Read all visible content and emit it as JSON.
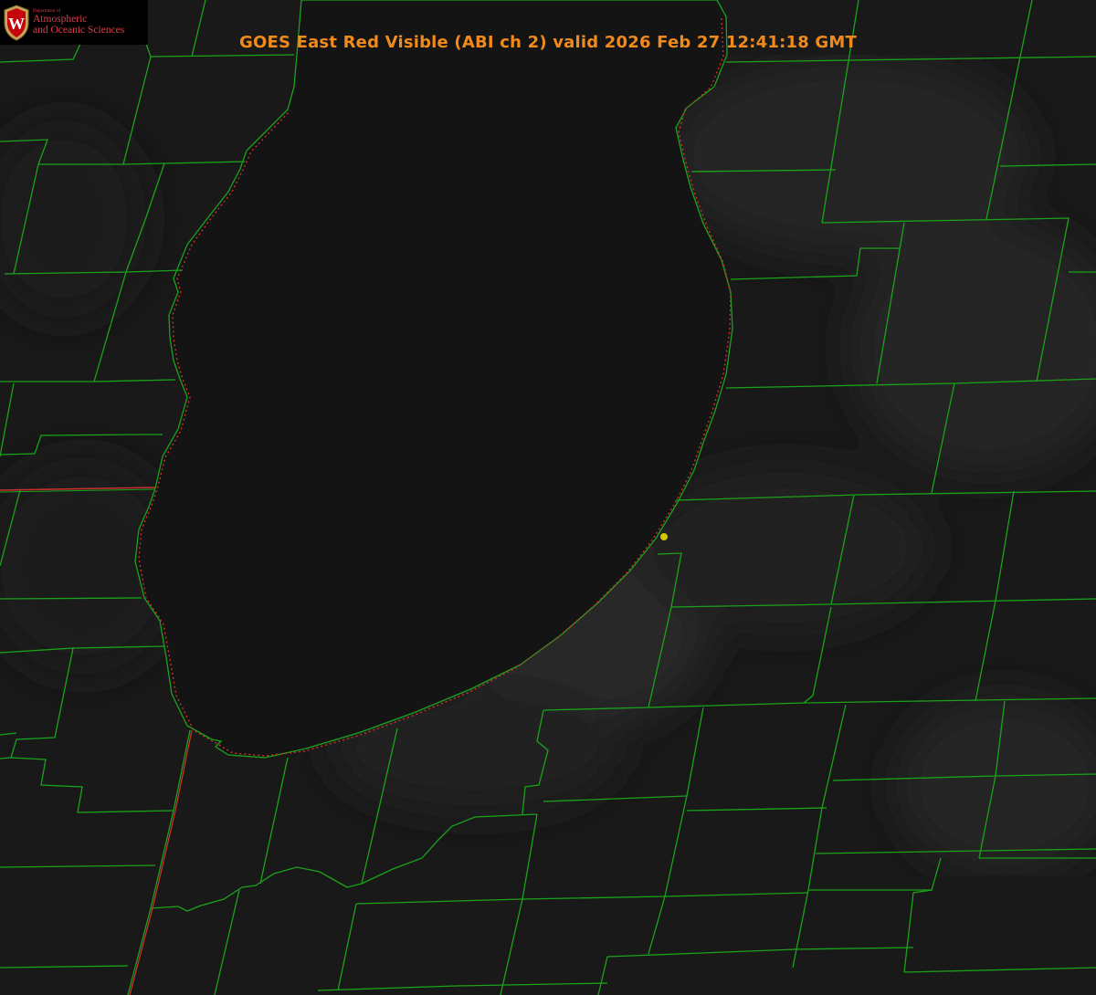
{
  "title": "GOES East Red Visible (ABI ch 2) valid 2026 Feb 27 12:41:18 GMT",
  "logo": {
    "department": "Department of",
    "line1": "Atmospheric",
    "line2": "and Oceanic Sciences",
    "crest_letter": "W",
    "icon": "uw-crest-icon"
  },
  "colors": {
    "background": "#171717",
    "lake": "#141414",
    "county_lines": "#1aa31a",
    "state_line": "#cc3030",
    "title": "#f08a1c",
    "logo_text": "#e23b4a",
    "marker": "#d4c800"
  },
  "map": {
    "layers": [
      "satellite-visible",
      "county-boundaries",
      "state-boundaries",
      "lake-shoreline"
    ],
    "marker_icon": "location-dot-icon"
  }
}
